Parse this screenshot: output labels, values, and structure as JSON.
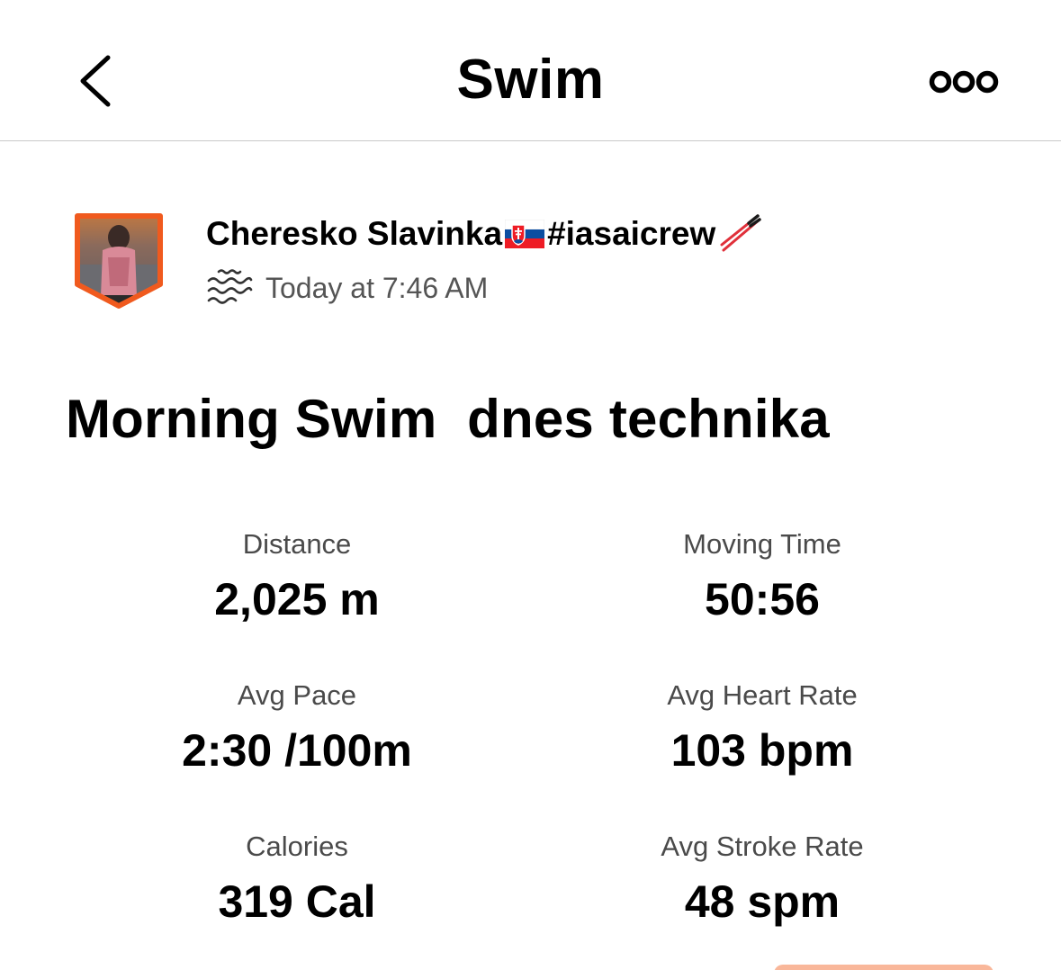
{
  "header": {
    "title": "Swim",
    "back_icon": "chevron-left-icon",
    "more_icon": "more-horizontal-icon"
  },
  "athlete": {
    "name_part1": "Cheresko Slavinka",
    "flag_icon": "slovakia-flag-icon",
    "name_part2": "#iasaicrew",
    "emoji_icon": "chopsticks-icon",
    "activity_icon": "swim-waves-icon",
    "timestamp": "Today at 7:46 AM",
    "avatar_border_color": "#f05a1e"
  },
  "activity": {
    "title": "Morning Swim  dnes technika"
  },
  "stats": [
    {
      "label": "Distance",
      "value": "2,025 m"
    },
    {
      "label": "Moving Time",
      "value": "50:56"
    },
    {
      "label": "Avg Pace",
      "value": "2:30 /100m"
    },
    {
      "label": "Avg Heart Rate",
      "value": "103 bpm"
    },
    {
      "label": "Calories",
      "value": "319 Cal"
    },
    {
      "label": "Avg Stroke Rate",
      "value": "48 spm"
    }
  ],
  "colors": {
    "accent": "#fc4c02",
    "label_gray": "#4a4a4a"
  }
}
